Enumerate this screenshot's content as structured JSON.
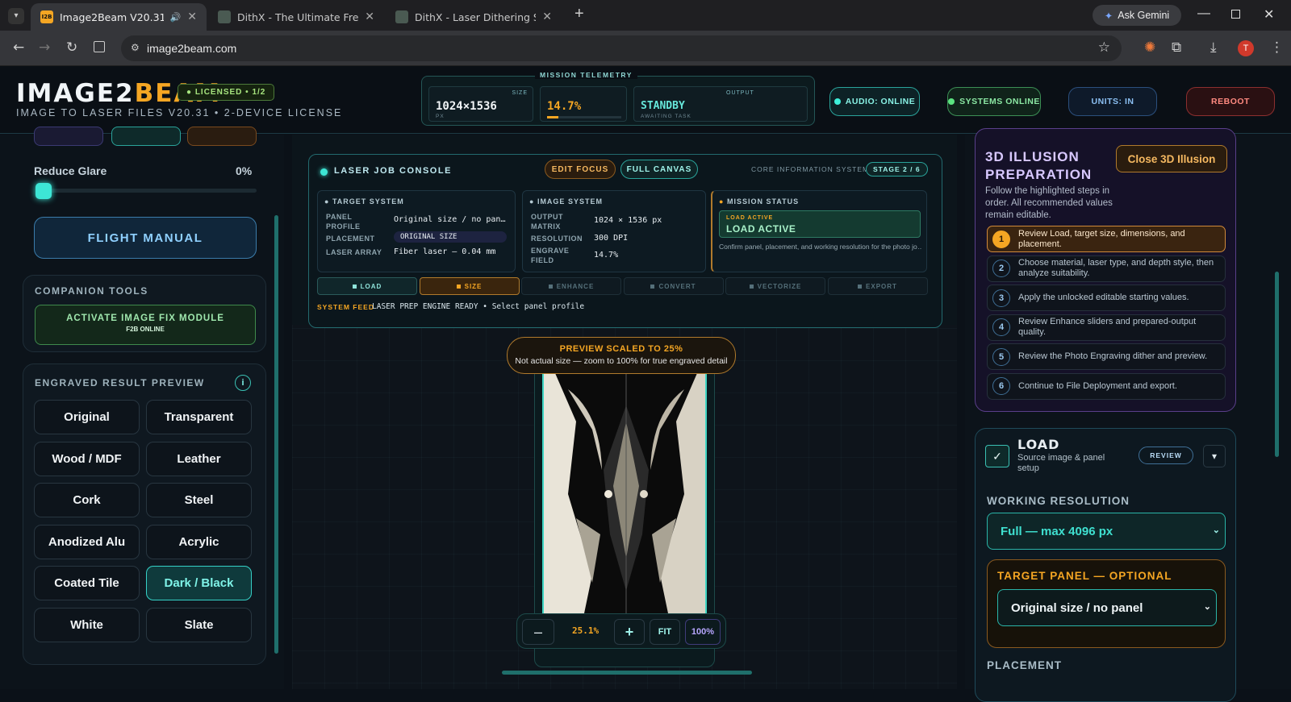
{
  "browser": {
    "tabs": [
      {
        "title": "Image2Beam V20.31",
        "active": true
      },
      {
        "title": "DithX - The Ultimate Free Laser",
        "active": false
      },
      {
        "title": "DithX - Laser Dithering Software",
        "active": false
      }
    ],
    "favicon_text": "I2B",
    "new_tab": "+",
    "ask_gemini": "Ask Gemini",
    "url": "image2beam.com",
    "avatar_letter": "T"
  },
  "header": {
    "logo_main": "IMAGE2",
    "logo_accent": "BEAM",
    "license_badge": "● LICENSED • 1/2",
    "subtitle": "IMAGE TO LASER FILES V20.31 • 2-DEVICE LICENSE",
    "telemetry_title": "MISSION TELEMETRY",
    "telemetry": {
      "size_label": "SIZE",
      "size_value": "1024×1536",
      "size_unit": "PX",
      "progress_value": "14.7%",
      "progress_fraction": 0.147,
      "output_label": "OUTPUT",
      "output_value": "STANDBY",
      "output_sub": "AWAITING TASK"
    },
    "audio": "AUDIO: ONLINE",
    "systems": "SYSTEMS ONLINE",
    "units": "UNITS: IN",
    "reboot": "REBOOT"
  },
  "left": {
    "reduce_glare_label": "Reduce Glare",
    "reduce_glare_value": "0%",
    "reduce_glare_fraction": 0,
    "flight_manual": "FLIGHT MANUAL",
    "companion_title": "COMPANION TOOLS",
    "image_fix_label": "ACTIVATE IMAGE FIX MODULE",
    "image_fix_sub": "F2B ONLINE",
    "preview_title": "ENGRAVED RESULT PREVIEW",
    "info_icon": "i",
    "materials": [
      "Original",
      "Transparent",
      "Wood / MDF",
      "Leather",
      "Cork",
      "Steel",
      "Anodized Alu",
      "Acrylic",
      "Coated Tile",
      "Dark / Black",
      "White",
      "Slate"
    ],
    "selected_material": "Dark / Black"
  },
  "console": {
    "title": "LASER JOB CONSOLE",
    "edit_focus": "EDIT FOCUS",
    "full_canvas": "FULL CANVAS",
    "core_info": "CORE INFORMATION SYSTEM",
    "stage": "STAGE 2 / 6",
    "target": {
      "heading": "TARGET SYSTEM",
      "panel_profile_label": "PANEL PROFILE",
      "panel_profile_value": "Original size / no pan…",
      "placement_label": "PLACEMENT",
      "placement_value": "ORIGINAL SIZE",
      "laser_label": "LASER ARRAY",
      "laser_value": "Fiber laser — 0.04 mm"
    },
    "image": {
      "heading": "IMAGE SYSTEM",
      "matrix_label": "OUTPUT MATRIX",
      "matrix_value": "1024 × 1536 px",
      "res_label": "RESOLUTION",
      "res_value": "300 DPI",
      "field_label": "ENGRAVE FIELD",
      "field_value": "14.7%"
    },
    "mission": {
      "heading": "MISSION STATUS",
      "small": "LOAD ACTIVE",
      "big": "LOAD ACTIVE",
      "desc": "Confirm panel, placement, and working resolution for the photo jo…"
    },
    "stages": [
      "LOAD",
      "SIZE",
      "ENHANCE",
      "CONVERT",
      "VECTORIZE",
      "EXPORT"
    ],
    "active_stage": "SIZE",
    "feed_label": "SYSTEM FEED",
    "feed_text": "LASER PREP ENGINE READY • Select panel profile"
  },
  "preview": {
    "badge_title": "PREVIEW SCALED TO 25%",
    "badge_sub": "Not actual size — zoom to 100% for true engraved detail",
    "zoom_minus": "–",
    "zoom_value": "25.1%",
    "zoom_plus": "+",
    "fit": "FIT",
    "hundred": "100%"
  },
  "right": {
    "illusion_title_1": "3D ILLUSION",
    "illusion_title_2": "PREPARATION",
    "close_btn": "Close 3D Illusion",
    "illusion_desc": "Follow the highlighted steps in order. All recommended values remain editable.",
    "steps": [
      {
        "n": "1",
        "text": "Review Load, target size, dimensions, and placement."
      },
      {
        "n": "2",
        "text": "Choose material, laser type, and depth style, then analyze suitability."
      },
      {
        "n": "3",
        "text": "Apply the unlocked editable starting values."
      },
      {
        "n": "4",
        "text": "Review Enhance sliders and prepared-output quality."
      },
      {
        "n": "5",
        "text": "Review the Photo Engraving dither and preview."
      },
      {
        "n": "6",
        "text": "Continue to File Deployment and export."
      }
    ],
    "load_title": "LOAD",
    "load_sub": "Source image & panel setup",
    "review_btn": "REVIEW",
    "working_res_label": "WORKING RESOLUTION",
    "working_res_value": "Full — max 4096 px",
    "target_panel_label": "TARGET PANEL — OPTIONAL",
    "target_panel_value": "Original size / no panel",
    "placement_cut": "PLACEMENT"
  }
}
